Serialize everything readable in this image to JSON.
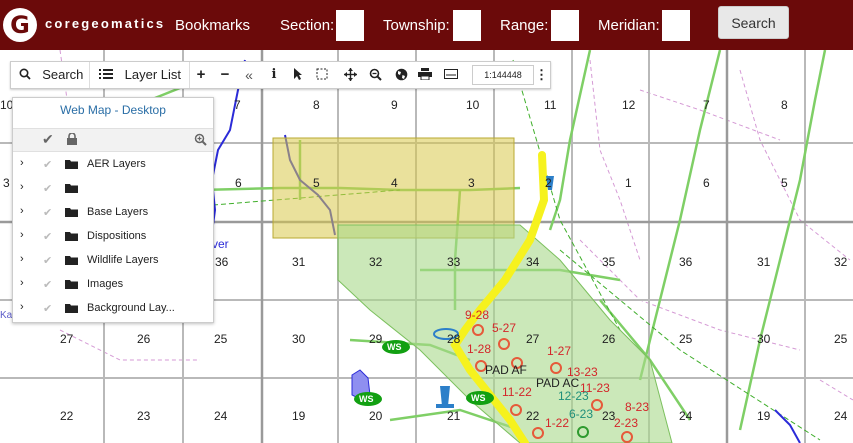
{
  "header": {
    "logo_text": "coregeomatics",
    "bookmarks_label": "Bookmarks",
    "section_label": "Section:",
    "township_label": "Township:",
    "range_label": "Range:",
    "meridian_label": "Meridian:",
    "search_button": "Search"
  },
  "toolbar": {
    "search_label": "Search",
    "layer_list_label": "Layer List",
    "scale": "1:144448"
  },
  "panel": {
    "title": "Web Map - Desktop",
    "layers": [
      {
        "label": "AER Layers"
      },
      {
        "label": ""
      },
      {
        "label": "Base Layers"
      },
      {
        "label": "Dispositions"
      },
      {
        "label": "Wildlife Layers"
      },
      {
        "label": "Images"
      },
      {
        "label": "Background Lay..."
      }
    ]
  },
  "map": {
    "section_labels": [
      "10",
      "7",
      "8",
      "9",
      "10",
      "11",
      "12",
      "7",
      "8",
      "3",
      "6",
      "5",
      "4",
      "3",
      "2",
      "1",
      "6",
      "5",
      "36",
      "31",
      "32",
      "33",
      "34",
      "35",
      "36",
      "31",
      "32",
      "27",
      "26",
      "25",
      "30",
      "29",
      "28",
      "27",
      "26",
      "25",
      "30",
      "25",
      "22",
      "23",
      "24",
      "19",
      "20",
      "21",
      "22",
      "23",
      "24",
      "19",
      "24"
    ],
    "well_labels": [
      "9-28",
      "5-27",
      "1-28",
      "PAD AF",
      "1-27",
      "PAD AC",
      "13-23",
      "11-22",
      "11-23",
      "12-23",
      "6-23",
      "8-23",
      "1-22",
      "2-23"
    ],
    "ws_label": "WS",
    "river_fragment": "ver",
    "edge_fragment": "Ka"
  }
}
